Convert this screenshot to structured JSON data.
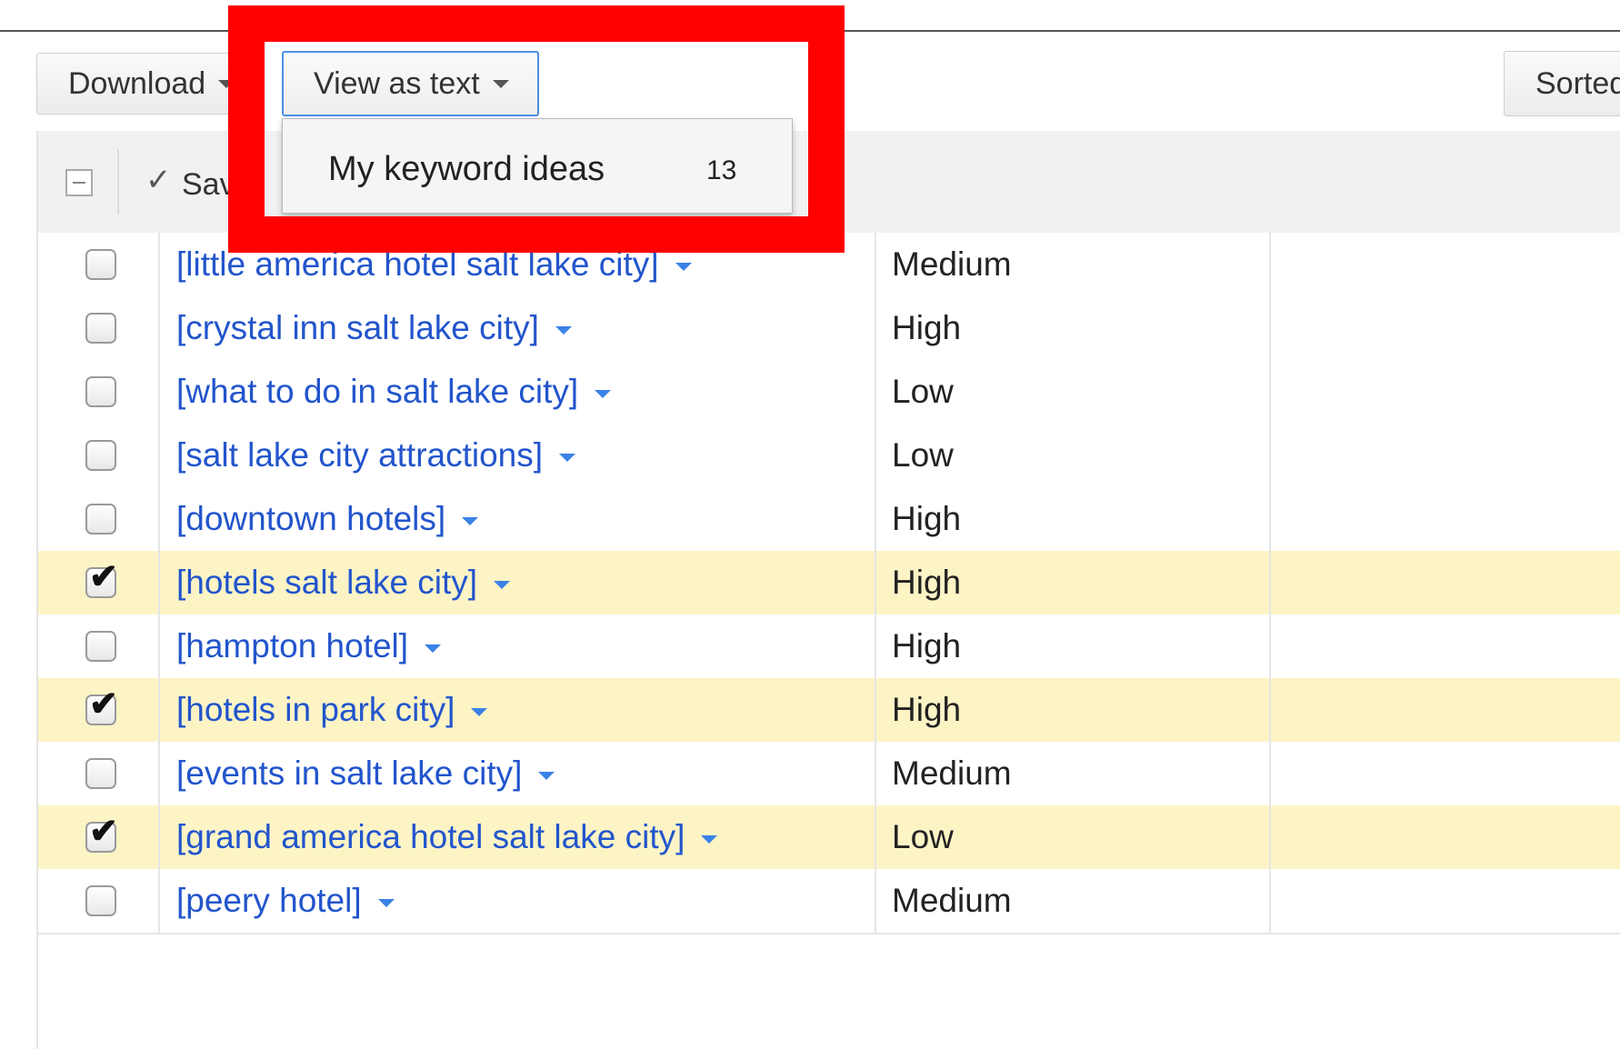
{
  "toolbar": {
    "download_label": "Download",
    "view_label": "View as text",
    "sorted_label": "Sorted"
  },
  "header": {
    "save_label": "Sav"
  },
  "dropdown": {
    "item_label": "My keyword ideas",
    "item_count": "13"
  },
  "rows": [
    {
      "keyword": "[little america hotel salt lake city]",
      "competition": "Medium",
      "checked": false
    },
    {
      "keyword": "[crystal inn salt lake city]",
      "competition": "High",
      "checked": false
    },
    {
      "keyword": "[what to do in salt lake city]",
      "competition": "Low",
      "checked": false
    },
    {
      "keyword": "[salt lake city attractions]",
      "competition": "Low",
      "checked": false
    },
    {
      "keyword": "[downtown hotels]",
      "competition": "High",
      "checked": false
    },
    {
      "keyword": "[hotels salt lake city]",
      "competition": "High",
      "checked": true
    },
    {
      "keyword": "[hampton hotel]",
      "competition": "High",
      "checked": false
    },
    {
      "keyword": "[hotels in park city]",
      "competition": "High",
      "checked": true
    },
    {
      "keyword": "[events in salt lake city]",
      "competition": "Medium",
      "checked": false
    },
    {
      "keyword": "[grand america hotel salt lake city]",
      "competition": "Low",
      "checked": true
    },
    {
      "keyword": "[peery hotel]",
      "competition": "Medium",
      "checked": false
    }
  ],
  "colors": {
    "highlight": "#ff0000",
    "selected_row": "#fdf4c6",
    "link": "#2255cc"
  }
}
